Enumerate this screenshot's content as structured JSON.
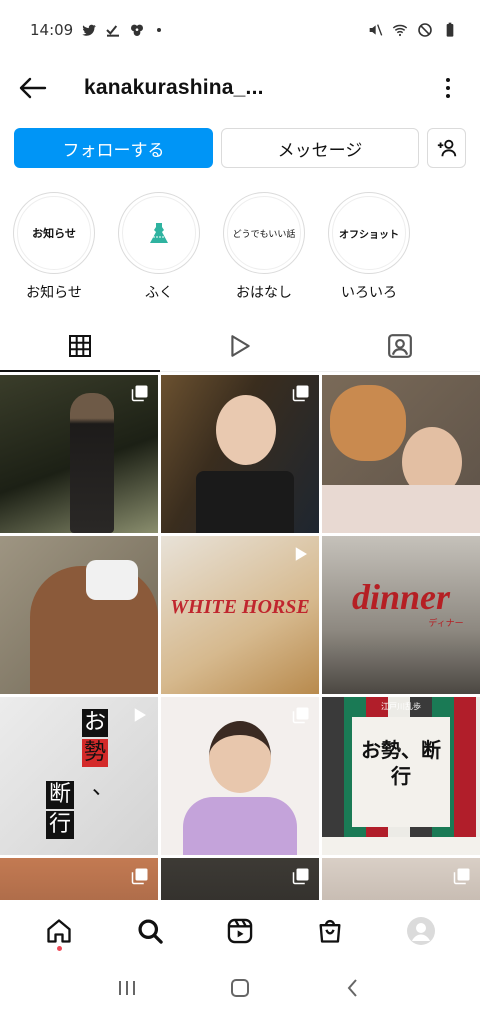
{
  "status_bar": {
    "time": "14:09"
  },
  "header": {
    "username": "kanakurashina_..."
  },
  "actions": {
    "follow_label": "フォローする",
    "message_label": "メッセージ"
  },
  "highlights": [
    {
      "cover": "お知らせ",
      "label": "お知らせ"
    },
    {
      "cover": "",
      "label": "ふく"
    },
    {
      "cover": "どうでもいい話",
      "label": "おはなし"
    },
    {
      "cover": "オフショット",
      "label": "いろいろ"
    }
  ],
  "tabs": [
    "posts-grid",
    "reels",
    "tagged"
  ],
  "grid": {
    "overlays": {
      "whitehorse": "WHITE HORSE",
      "dinner": "dinner",
      "dinner_sub": "ディナー",
      "osei_1": "お",
      "osei_2": "勢",
      "osei_3": "、",
      "osei_4": "断",
      "osei_5": "行",
      "poster_title": "お勢、断行",
      "poster_small": "江戸川乱歩"
    }
  },
  "colors": {
    "follow": "#0095f6",
    "accent_dot": "#ed4956"
  }
}
